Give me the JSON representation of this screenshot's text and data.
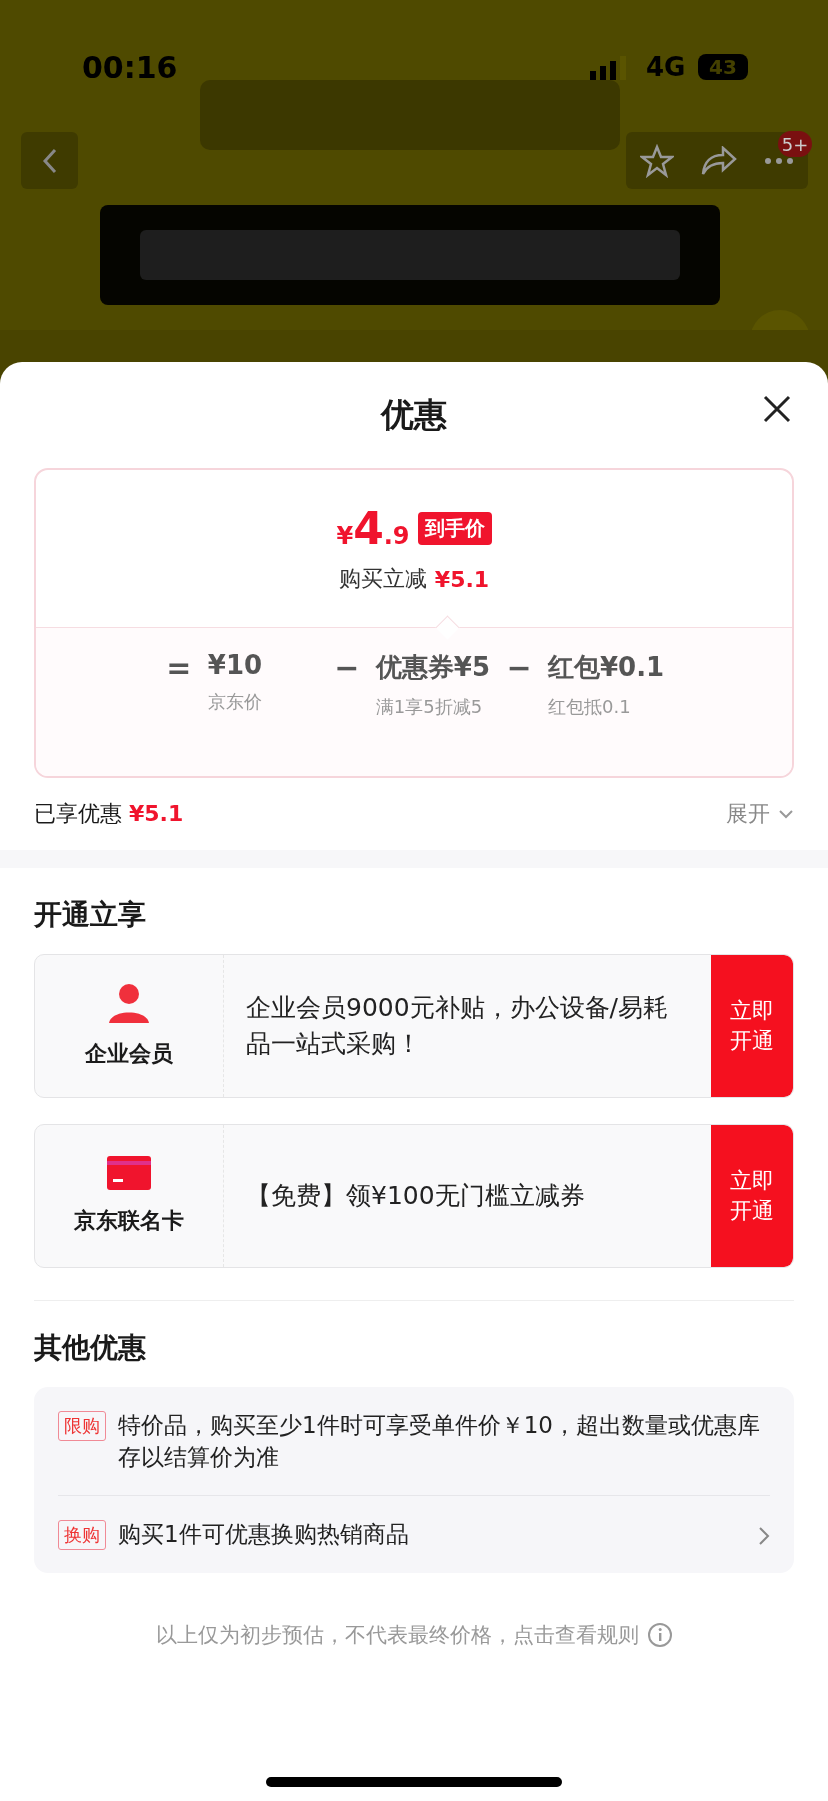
{
  "status_bar": {
    "time": "00:16",
    "network": "4G",
    "battery": "43"
  },
  "product_header": {
    "badge": "5+"
  },
  "sheet": {
    "title": "优惠"
  },
  "price_card": {
    "currency": "¥",
    "price_int": "4",
    "price_dec": ".9",
    "price_tag": "到手价",
    "reduce_label": "购买立减",
    "reduce_amount": "¥5.1",
    "formula": [
      {
        "kind": "operator",
        "text": "="
      },
      {
        "kind": "term",
        "text": "¥10",
        "note": "京东价"
      },
      {
        "kind": "operator",
        "text": "−"
      },
      {
        "kind": "term",
        "text": "优惠券¥5",
        "note": "满1享5折减5"
      },
      {
        "kind": "operator",
        "text": "−"
      },
      {
        "kind": "term",
        "text": "红包¥0.1",
        "note": "红包抵0.1"
      }
    ]
  },
  "enjoyed": {
    "label": "已享优惠",
    "amount": "¥5.1",
    "expand": "展开"
  },
  "open_section": {
    "title": "开通立享",
    "cards": [
      {
        "kind": "person",
        "name": "企业会员",
        "desc": "企业会员9000元补贴，办公设备/易耗品一站式采购！",
        "action": "立即开通"
      },
      {
        "kind": "card",
        "name": "京东联名卡",
        "desc": "【免费】领¥100无门槛立减券",
        "action": "立即开通"
      }
    ]
  },
  "other_section": {
    "title": "其他优惠",
    "items": [
      {
        "tag": "限购",
        "text": "特价品，购买至少1件时可享受单件价￥10，超出数量或优惠库存以结算价为准",
        "has_arrow": false
      },
      {
        "tag": "换购",
        "text": "购买1件可优惠换购热销商品",
        "has_arrow": true
      }
    ]
  },
  "footer_note": "以上仅为初步预估，不代表最终价格，点击查看规则"
}
